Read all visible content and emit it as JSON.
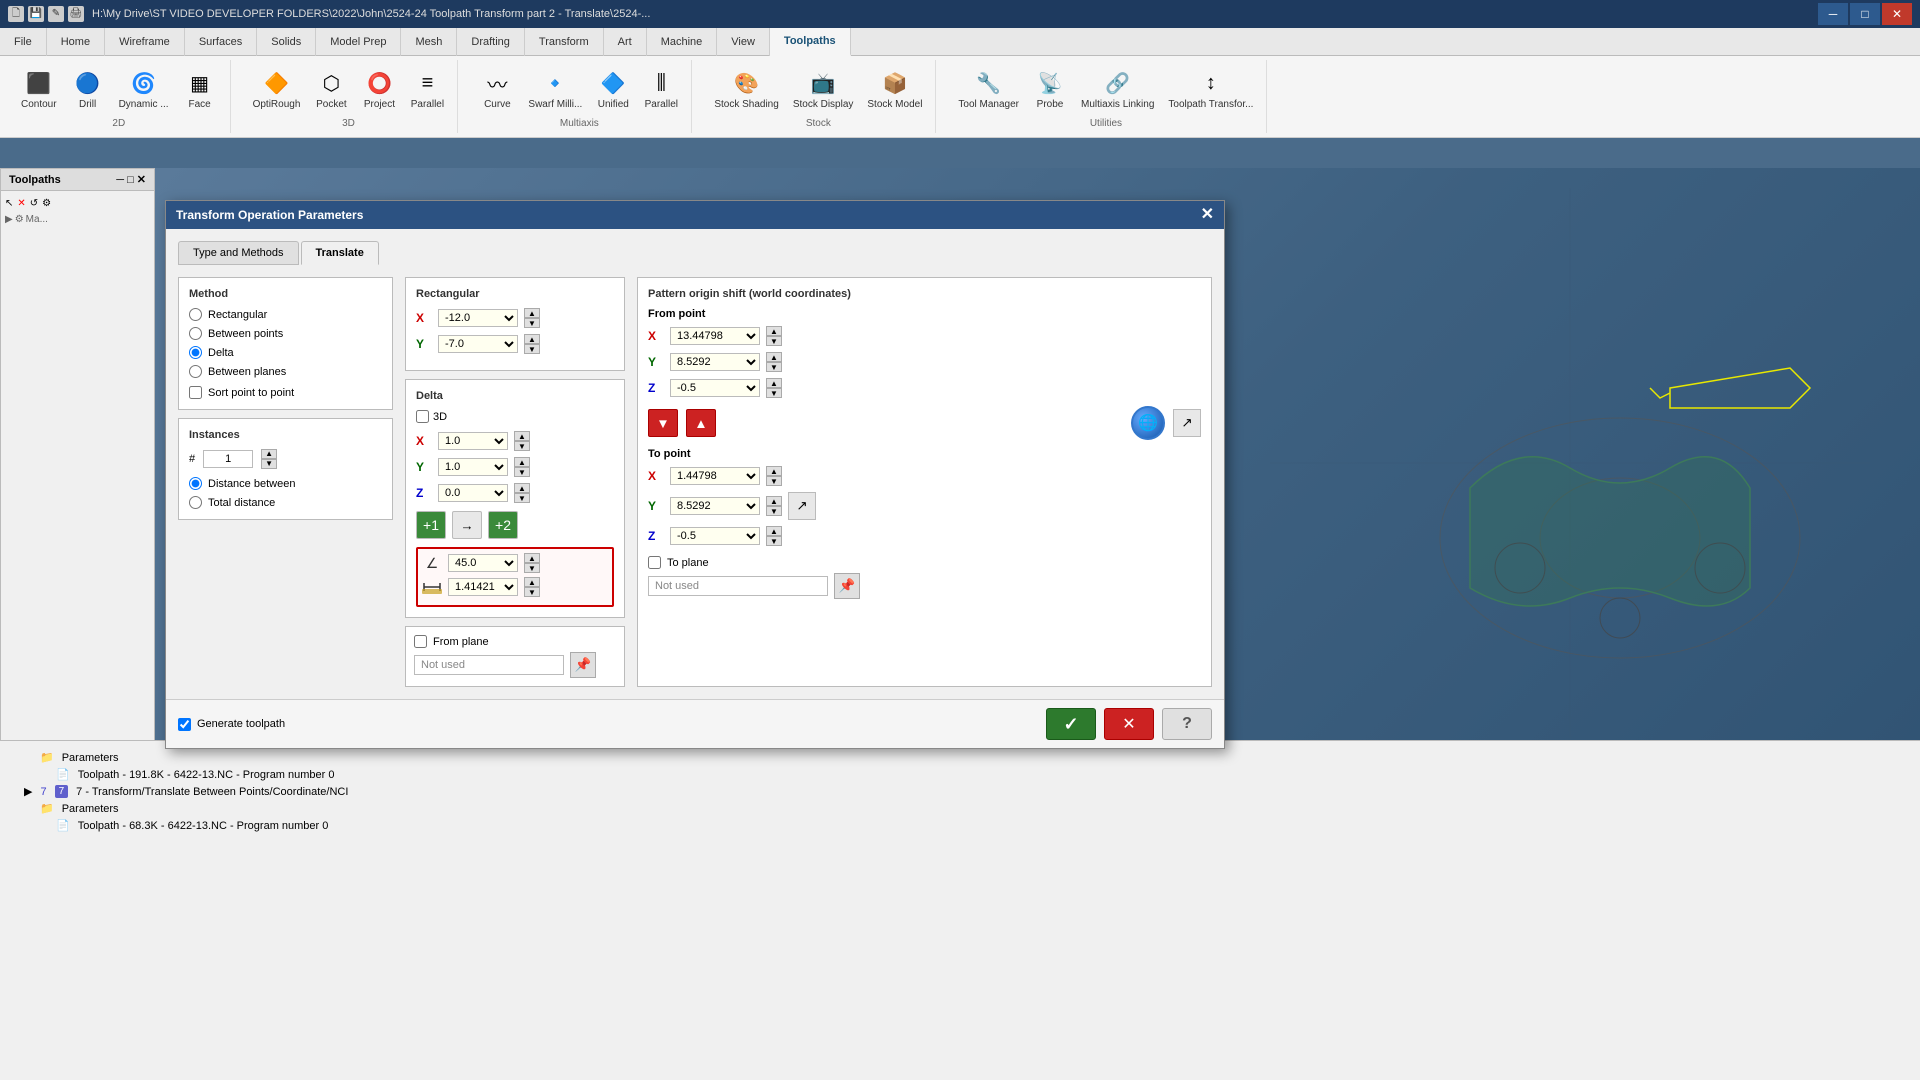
{
  "titlebar": {
    "path": "H:\\My Drive\\ST VIDEO DEVELOPER FOLDERS\\2022\\John\\2524-24 Toolpath Transform part 2 - Translate\\2524-...",
    "minimize": "─",
    "maximize": "□",
    "close": "✕"
  },
  "ribbon": {
    "tabs": [
      "File",
      "Home",
      "Wireframe",
      "Surfaces",
      "Solids",
      "Model Prep",
      "Mesh",
      "Drafting",
      "Transform",
      "Art",
      "Machine",
      "View",
      "Toolpaths"
    ],
    "active_tab": "Toolpaths",
    "groups": {
      "2d": {
        "label": "2D",
        "items": [
          "Contour",
          "Drill",
          "Dynamic ...",
          "Face"
        ]
      },
      "3d": {
        "label": "3D",
        "items": [
          "OptiRough",
          "Pocket",
          "Project",
          "Parallel"
        ]
      },
      "multiaxis": {
        "label": "Multiaxis",
        "items": [
          "Curve",
          "Swarf Milli...",
          "Unified",
          "Parallel"
        ]
      },
      "stock": {
        "label": "Stock",
        "items": [
          "Stock Shading",
          "Stock Display",
          "Stock Model"
        ]
      },
      "utilities": {
        "label": "Utilities",
        "items": [
          "Tool Manager",
          "Probe",
          "Multiaxis Linking",
          "Toolpath Transfor..."
        ]
      }
    }
  },
  "dialog": {
    "title": "Transform Operation Parameters",
    "tabs": [
      "Type and Methods",
      "Translate"
    ],
    "active_tab": "Translate",
    "method": {
      "title": "Method",
      "options": [
        "Rectangular",
        "Between points",
        "Delta",
        "Between planes"
      ],
      "selected": "Delta",
      "sort_point_to_point": false,
      "sort_label": "Sort point to point"
    },
    "instances": {
      "title": "Instances",
      "hash_label": "#",
      "value": "1",
      "distance_between_label": "Distance between",
      "total_distance_label": "Total distance",
      "distance_between_selected": true
    },
    "rectangular": {
      "title": "Rectangular",
      "x_label": "X",
      "y_label": "Y",
      "x_value": "-12.0",
      "y_value": "-7.0"
    },
    "delta": {
      "title": "Delta",
      "checkbox_3d": "3D",
      "x_label": "X",
      "y_label": "Y",
      "z_label": "Z",
      "x_value": "1.0",
      "y_value": "1.0",
      "z_value": "0.0",
      "angle_value": "45.0",
      "distance_value": "1.41421"
    },
    "pattern_origin": {
      "title": "Pattern origin shift (world coordinates)",
      "from_point_title": "From point",
      "from_x": "13.44798",
      "from_y": "8.5292",
      "from_z": "-0.5",
      "to_point_title": "To point",
      "to_x": "1.44798",
      "to_y": "8.5292",
      "to_z": "-0.5"
    },
    "from_plane": {
      "checkbox_label": "From plane",
      "checked": false,
      "placeholder": "Not used"
    },
    "to_plane": {
      "checkbox_label": "To plane",
      "checked": false,
      "placeholder": "Not used"
    },
    "generate_toolpath": {
      "label": "Generate toolpath",
      "checked": true
    },
    "ok_label": "✓",
    "cancel_label": "✕",
    "help_label": "?"
  },
  "toolpaths_panel": {
    "title": "Toolpaths",
    "items": []
  },
  "bottom_panel": {
    "items": [
      {
        "indent": 2,
        "type": "folder",
        "icon": "📁",
        "text": "Parameters"
      },
      {
        "indent": 3,
        "type": "file",
        "icon": "📄",
        "text": "Toolpath - 191.8K - 6422-13.NC - Program number 0"
      },
      {
        "indent": 1,
        "type": "folder",
        "icon": "📁",
        "text": "7 - Transform/Translate Between Points/Coordinate/NCI"
      },
      {
        "indent": 2,
        "type": "folder",
        "icon": "📁",
        "text": "Parameters"
      },
      {
        "indent": 3,
        "type": "file",
        "icon": "📄",
        "text": "Toolpath - 68.3K - 6422-13.NC - Program number 0"
      }
    ]
  }
}
